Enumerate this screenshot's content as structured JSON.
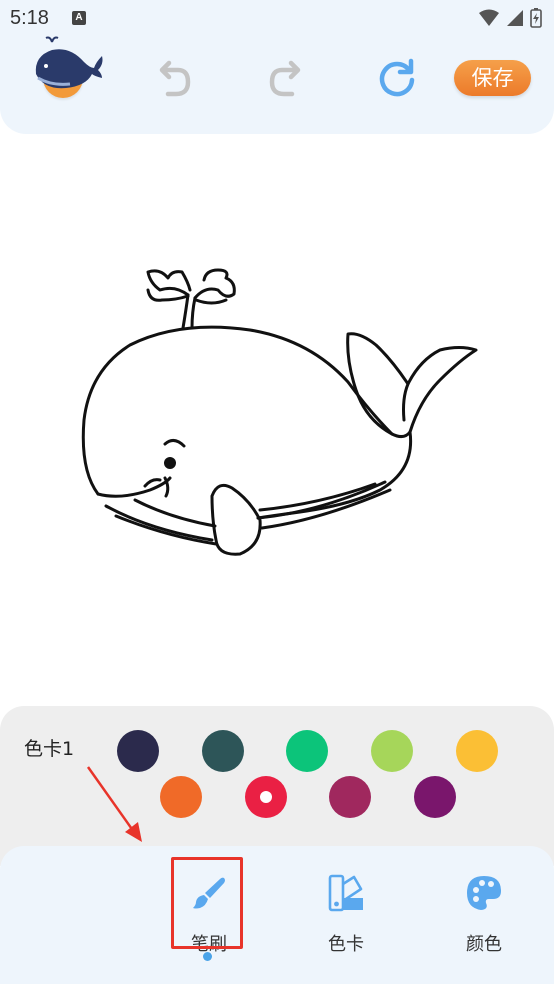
{
  "status_bar": {
    "time": "5:18",
    "app_icon_letter": "A"
  },
  "toolbar": {
    "back_icon": "chevron-left-icon",
    "undo_icon": "undo-icon",
    "redo_icon": "redo-icon",
    "reset_icon": "refresh-icon",
    "save_label": "保存",
    "accent_color": "#f29a3a"
  },
  "canvas": {
    "image": "whale line drawing (uncolored)"
  },
  "palette": {
    "title": "色卡1",
    "swatches": [
      {
        "color": "#2b2a4c",
        "selected": false
      },
      {
        "color": "#2d5558",
        "selected": false
      },
      {
        "color": "#0cc47a",
        "selected": false
      },
      {
        "color": "#a6d65a",
        "selected": false
      },
      {
        "color": "#fbbf35",
        "selected": false
      },
      {
        "color": "#f06a28",
        "selected": false
      },
      {
        "color": "#ea2044",
        "selected": true
      },
      {
        "color": "#a0285e",
        "selected": false
      },
      {
        "color": "#7a166c",
        "selected": false
      }
    ]
  },
  "bottom_nav": {
    "tabs": [
      {
        "label": "笔刷",
        "icon": "brush-icon",
        "active": true
      },
      {
        "label": "色卡",
        "icon": "swatch-card-icon",
        "active": false
      },
      {
        "label": "颜色",
        "icon": "palette-icon",
        "active": false
      }
    ],
    "active_color": "#4aa3e8"
  }
}
